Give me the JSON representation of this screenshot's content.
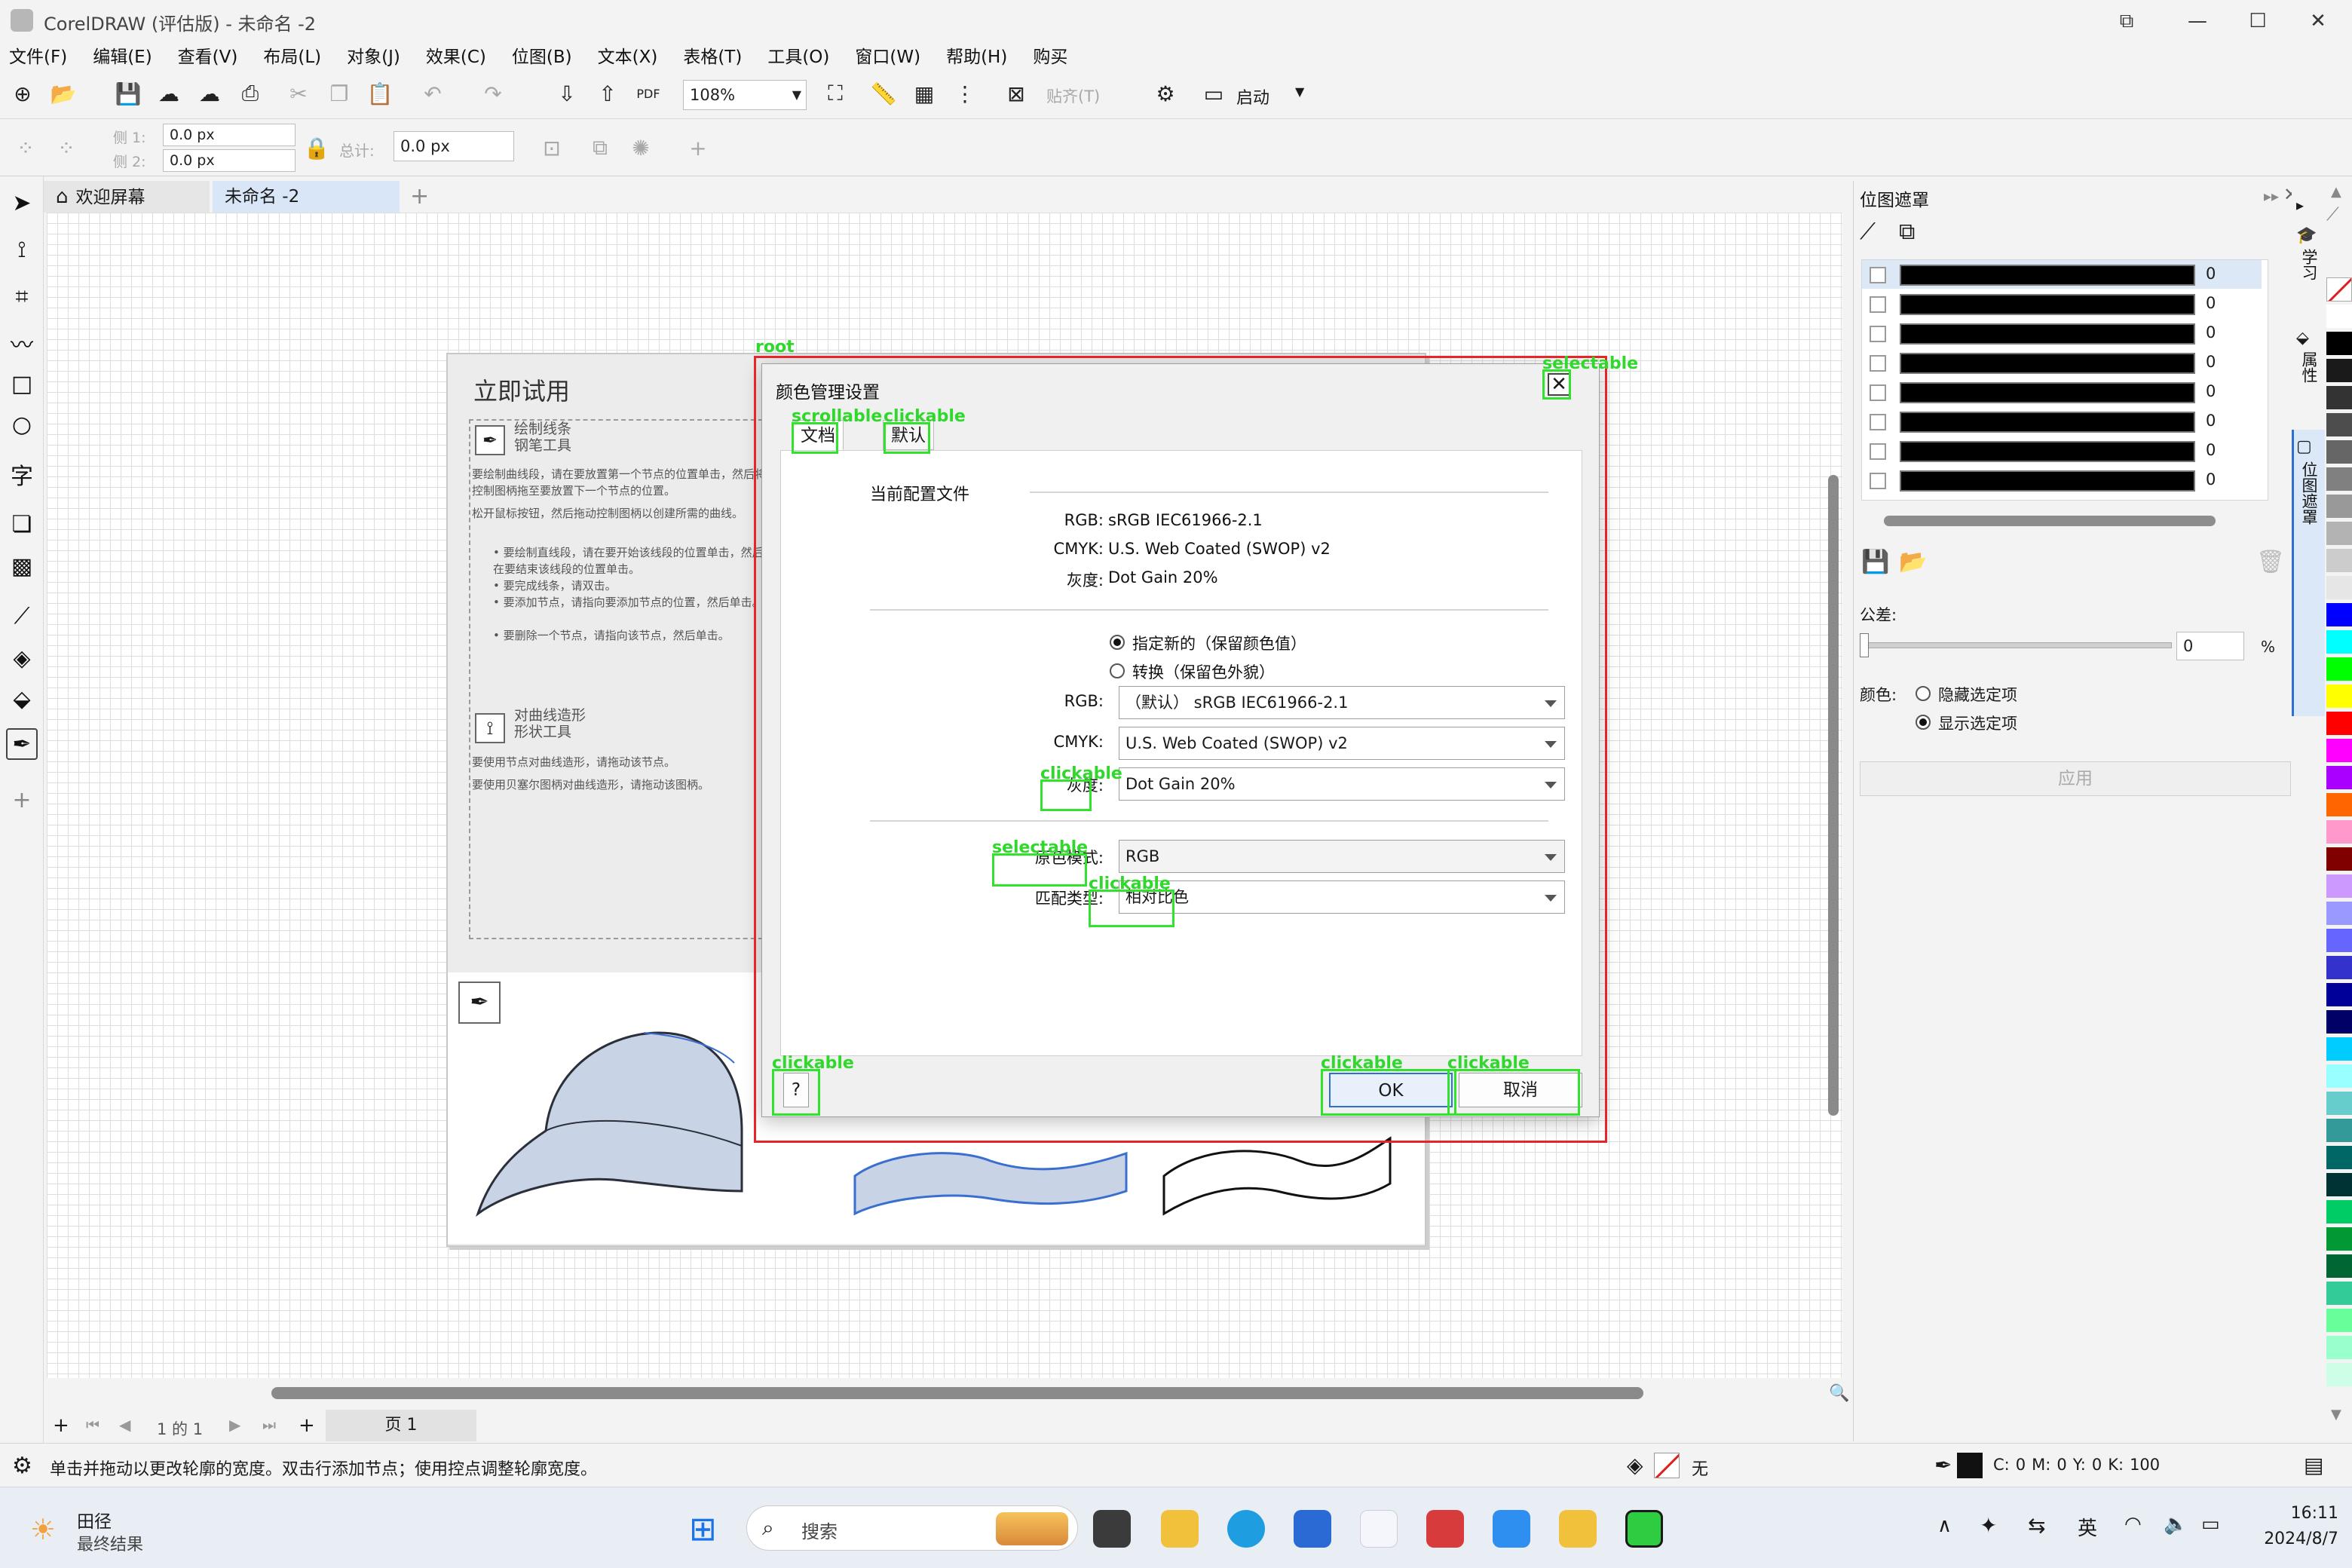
{
  "app": {
    "title": "CorelDRAW (评估版) - 未命名 -2",
    "window_buttons": [
      "⧉",
      "—",
      "☐",
      "✕"
    ]
  },
  "menu": [
    "文件(F)",
    "编辑(E)",
    "查看(V)",
    "布局(L)",
    "对象(J)",
    "效果(C)",
    "位图(B)",
    "文本(X)",
    "表格(T)",
    "工具(O)",
    "窗口(W)",
    "帮助(H)",
    "购买"
  ],
  "toolbar": {
    "zoom": "108%",
    "paste_label": "贴齐(T)",
    "launch_label": "启动",
    "side1_label": "侧 1:",
    "side2_label": "侧 2:",
    "side1_value": "0.0 px",
    "side2_value": "0.0 px",
    "total_label": "总计:",
    "total_value": "0.0 px"
  },
  "tabs": {
    "welcome": "欢迎屏幕",
    "document": "未命名 -2",
    "add": "+"
  },
  "welcome_page": {
    "heading": "立即试用",
    "tool1_title": "绘制线条",
    "tool1_subtitle": "钢笔工具",
    "para1": "要绘制曲线段，请在要放置第一个节点的位置单击，然后将控制图柄拖至要放置下一个节点的位置。",
    "para2": "松开鼠标按钮，然后拖动控制图柄以创建所需的曲线。",
    "bullet1": "• 要绘制直线段，请在要开始该线段的位置单击，然后在要结束该线段的位置单击。",
    "bullet2": "• 要完成线条，请双击。",
    "bullet3": "• 要添加节点，请指向要添加节点的位置，然后单击。",
    "bullet4": "• 要删除一个节点，请指向该节点，然后单击。",
    "tool2_title": "对曲线造形",
    "tool2_subtitle": "形状工具",
    "para3": "要使用节点对曲线造形，请拖动该节点。",
    "para4": "要使用贝塞尔图柄对曲线造形，请拖动该图柄。"
  },
  "dialog": {
    "title": "颜色管理设置",
    "close": "✕",
    "tab_document": "文档",
    "tab_default": "默认",
    "current_profiles_label": "当前配置文件",
    "rgb_label": "RGB:",
    "rgb_value": "sRGB IEC61966-2.1",
    "cmyk_label": "CMYK:",
    "cmyk_value": "U.S. Web Coated (SWOP) v2",
    "gray_label": "灰度:",
    "gray_value": "Dot Gain 20%",
    "radio_assign": "指定新的（保留颜色值）",
    "radio_convert": "转换（保留色外貌）",
    "rgb_combo": "（默认）  sRGB IEC61966-2.1",
    "cmyk_combo": "U.S. Web Coated (SWOP) v2",
    "gray_combo": "Dot Gain 20%",
    "primary_mode_label": "原色模式:",
    "primary_mode_value": "RGB",
    "match_type_label": "匹配类型:",
    "match_type_value": "相对比色",
    "help": "?",
    "ok": "OK",
    "cancel": "取消"
  },
  "annotations": {
    "root": "root",
    "selectable": "selectable",
    "scrollable": "scrollable",
    "clickable": "clickable"
  },
  "docker": {
    "title": "位图遮罩",
    "mask_values": [
      "0",
      "0",
      "0",
      "0",
      "0",
      "0",
      "0",
      "0"
    ],
    "tolerance_label": "公差:",
    "tolerance_value": "0",
    "tolerance_unit": "%",
    "color_label": "颜色:",
    "hide_option": "隐藏选定项",
    "show_option": "显示选定项",
    "apply": "应用"
  },
  "side_tabs": [
    "学习",
    "属性",
    "位图遮罩"
  ],
  "palette_colors": [
    "#ffffff",
    "#000000",
    "#1a1a1a",
    "#333333",
    "#4d4d4d",
    "#666666",
    "#808080",
    "#999999",
    "#b3b3b3",
    "#cccccc",
    "#e6e6e6",
    "#0000ff",
    "#00ffff",
    "#00ff00",
    "#ffff00",
    "#ff0000",
    "#ff00ff",
    "#aa00ff",
    "#ff6600",
    "#ff99cc",
    "#800000",
    "#cc99ff",
    "#9999ff",
    "#6666ff",
    "#3333cc",
    "#000099",
    "#000066",
    "#00ccff",
    "#99ffff",
    "#66cccc",
    "#339999",
    "#006666",
    "#003333",
    "#00cc66",
    "#009933",
    "#006633",
    "#33cc99",
    "#66ff99",
    "#99ffcc",
    "#ccffe6"
  ],
  "page_nav": {
    "page_of": "1 的 1",
    "page_tab": "页 1"
  },
  "status": {
    "hint": "单击并拖动以更改轮廓的宽度。双击行添加节点；使用控点调整轮廓宽度。",
    "fill_none": "无",
    "c_label": "C:",
    "c_value": "0",
    "m_label": "M:",
    "m_value": "0",
    "y_label": "Y:",
    "y_value": "0",
    "k_label": "K:",
    "k_value": "100"
  },
  "taskbar": {
    "weather_title": "田径",
    "weather_sub": "最终结果",
    "search_placeholder": "搜索",
    "ime": "英",
    "time": "16:11",
    "date": "2024/8/7"
  }
}
